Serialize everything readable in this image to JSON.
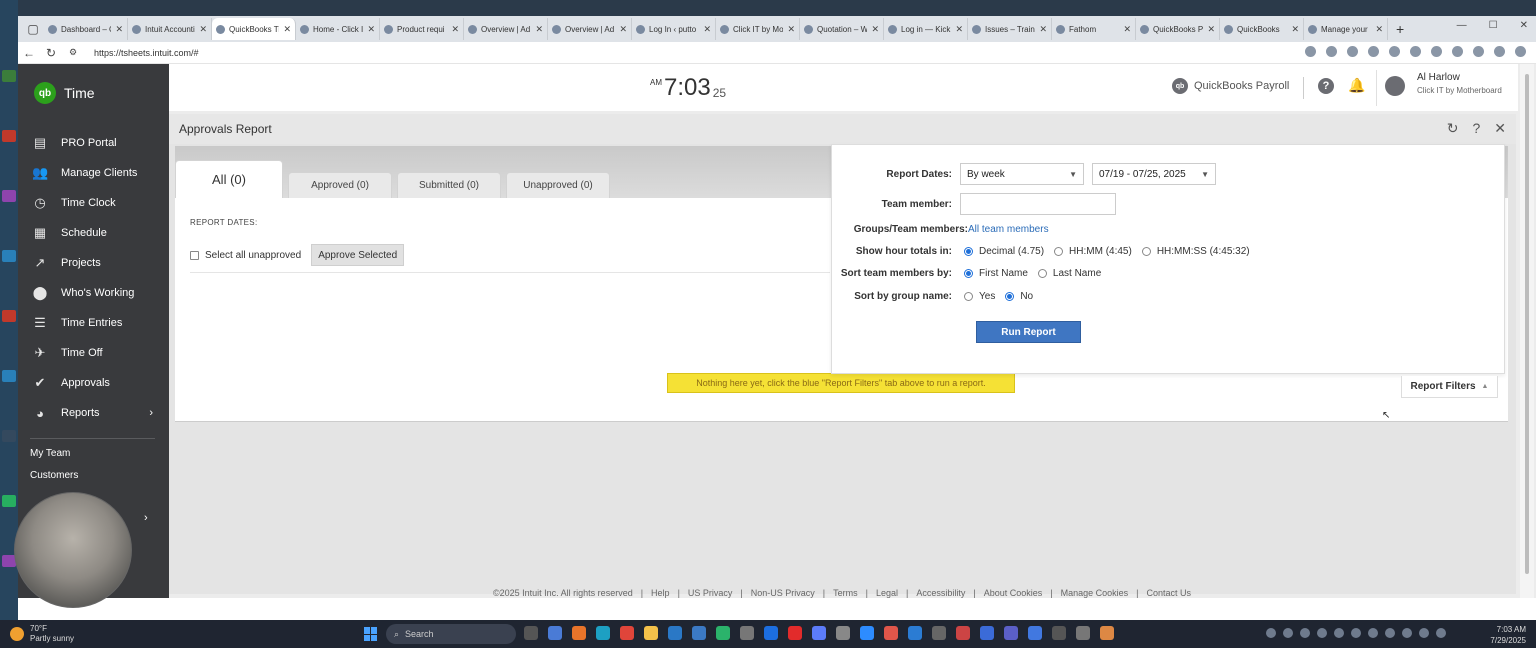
{
  "browser": {
    "tabs": [
      {
        "label": "Dashboard – C",
        "active": false
      },
      {
        "label": "Intuit Accounti",
        "active": false
      },
      {
        "label": "QuickBooks Ti",
        "active": true
      },
      {
        "label": "Home - Click I",
        "active": false
      },
      {
        "label": "Product requi",
        "active": false
      },
      {
        "label": "Overview | Ad",
        "active": false
      },
      {
        "label": "Overview | Ad",
        "active": false
      },
      {
        "label": "Log In ‹ putto",
        "active": false
      },
      {
        "label": "Click IT by Mo",
        "active": false
      },
      {
        "label": "Quotation – W",
        "active": false
      },
      {
        "label": "Log in — Kick",
        "active": false
      },
      {
        "label": "Issues – Traini",
        "active": false
      },
      {
        "label": "Fathom",
        "active": false
      },
      {
        "label": "QuickBooks Pa",
        "active": false
      },
      {
        "label": "QuickBooks",
        "active": false
      },
      {
        "label": "Manage your",
        "active": false
      }
    ],
    "tab_close": "✕",
    "new_tab": "+",
    "window_controls": [
      "—",
      "☐",
      "✕"
    ],
    "url": "https://tsheets.intuit.com/#"
  },
  "sidebar": {
    "logo_text": "qb",
    "app_title": "Time",
    "items": [
      {
        "label": "PRO Portal",
        "icon": "portal-icon",
        "glyph": "▤"
      },
      {
        "label": "Manage Clients",
        "icon": "people-icon",
        "glyph": "👥"
      },
      {
        "label": "Time Clock",
        "icon": "clock-icon",
        "glyph": "◷"
      },
      {
        "label": "Schedule",
        "icon": "calendar-icon",
        "glyph": "▦"
      },
      {
        "label": "Projects",
        "icon": "trend-icon",
        "glyph": "↗"
      },
      {
        "label": "Who's Working",
        "icon": "location-pin-icon",
        "glyph": "⬤"
      },
      {
        "label": "Time Entries",
        "icon": "list-clock-icon",
        "glyph": "☰"
      },
      {
        "label": "Time Off",
        "icon": "airplane-icon",
        "glyph": "✈"
      },
      {
        "label": "Approvals",
        "icon": "double-check-icon",
        "glyph": "✔"
      },
      {
        "label": "Reports",
        "icon": "pie-chart-icon",
        "glyph": "◕",
        "arrow": "›"
      }
    ],
    "links": [
      "My Team",
      "Customers"
    ],
    "more_arrow": "›"
  },
  "topbar": {
    "ampm": "AM",
    "time": "7:03",
    "seconds": "25",
    "payroll_label": "QuickBooks Payroll",
    "payroll_icon": "qb",
    "help": "?",
    "bell": "🔔",
    "user_name": "Al Harlow",
    "user_company": "Click IT by Motherboard"
  },
  "report": {
    "title": "Approvals Report",
    "header_icons": [
      "↻",
      "?",
      "✕"
    ],
    "tabs": [
      {
        "label": "All (0)",
        "active": true
      },
      {
        "label": "Approved (0)",
        "active": false
      },
      {
        "label": "Submitted (0)",
        "active": false
      },
      {
        "label": "Unapproved (0)",
        "active": false
      }
    ],
    "dates_label": "REPORT DATES:",
    "select_all_label": "Select all unapproved",
    "approve_button": "Approve Selected",
    "empty_message": "Nothing here yet, click the blue \"Report Filters\" tab above to run a report."
  },
  "filters": {
    "report_dates_label": "Report Dates:",
    "period_value": "By week",
    "range_value": "07/19 - 07/25, 2025",
    "team_member_label": "Team member:",
    "team_member_value": "",
    "groups_label": "Groups/Team members:",
    "groups_value": "All team members",
    "hour_totals_label": "Show hour totals in:",
    "hour_options": [
      {
        "label": "Decimal (4.75)",
        "selected": true
      },
      {
        "label": "HH:MM (4:45)",
        "selected": false
      },
      {
        "label": "HH:MM:SS (4:45:32)",
        "selected": false
      }
    ],
    "sort_members_label": "Sort team members by:",
    "sort_options": [
      {
        "label": "First Name",
        "selected": true
      },
      {
        "label": "Last Name",
        "selected": false
      }
    ],
    "sort_group_label": "Sort by group name:",
    "group_options": [
      {
        "label": "Yes",
        "selected": false
      },
      {
        "label": "No",
        "selected": true
      }
    ],
    "run_button": "Run Report",
    "filters_tab": "Report Filters",
    "caret": "▼",
    "up_caret": "▲"
  },
  "footer": {
    "items": [
      "©2025 Intuit Inc. All rights reserved",
      "Help",
      "US Privacy",
      "Non-US Privacy",
      "Terms",
      "Legal",
      "Accessibility",
      "About Cookies",
      "Manage Cookies",
      "Contact Us"
    ],
    "separator": "|"
  },
  "taskbar": {
    "temp": "70°F",
    "weather": "Partly sunny",
    "search_placeholder": "Search",
    "time": "7:03 AM",
    "date": "7/29/2025"
  },
  "colors": {
    "sidebar_bg": "#393a3d",
    "qb_green": "#2ca01c",
    "run_button": "#3f76c2",
    "empty_banner": "#f5e135",
    "link": "#2b6cb8"
  }
}
